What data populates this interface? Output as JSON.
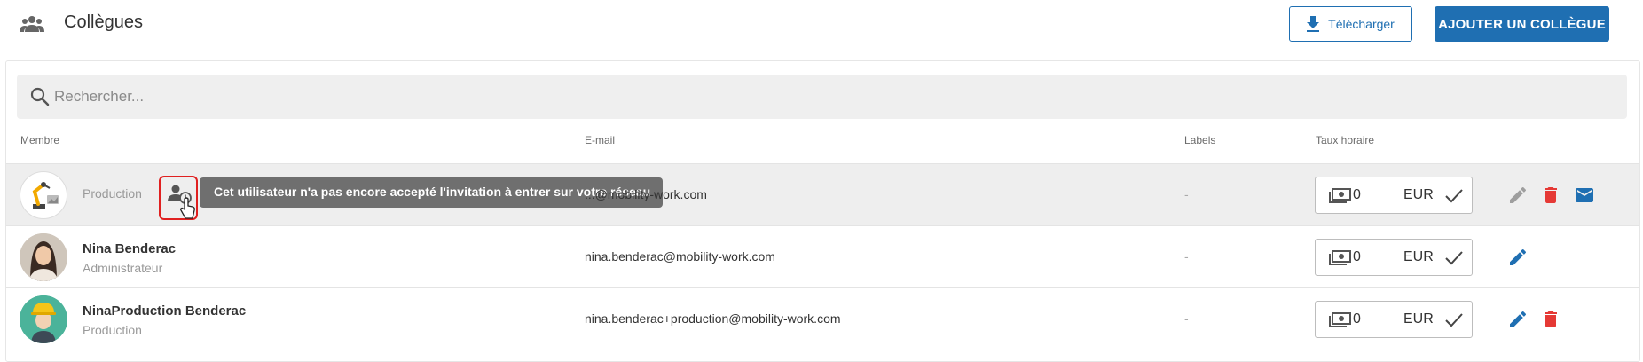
{
  "header": {
    "title": "Collègues",
    "download_label": "Télécharger",
    "add_label": "AJOUTER UN COLLÈGUE"
  },
  "search": {
    "placeholder": "Rechercher..."
  },
  "columns": {
    "member": "Membre",
    "email": "E-mail",
    "labels": "Labels",
    "rate": "Taux horaire"
  },
  "tooltip": "Cet utilisateur n'a pas encore accepté l'invitation à entrer sur votre réseau",
  "rows": [
    {
      "name": "",
      "role": "Production",
      "email": "...@mobility-work.com",
      "label": "-",
      "rate": "0",
      "currency": "EUR",
      "pending": true
    },
    {
      "name": "Nina Benderac",
      "role": "Administrateur",
      "email": "nina.benderac@mobility-work.com",
      "label": "-",
      "rate": "0",
      "currency": "EUR"
    },
    {
      "name": "NinaProduction Benderac",
      "role": "Production",
      "email": "nina.benderac+production@mobility-work.com",
      "label": "-",
      "rate": "0",
      "currency": "EUR"
    }
  ],
  "colors": {
    "primary": "#1f6fb2",
    "delete": "#e53935",
    "edit_disabled": "#9e9e9e",
    "tooltip_bg": "#6f6f6f",
    "highlight_border": "#e02020"
  }
}
